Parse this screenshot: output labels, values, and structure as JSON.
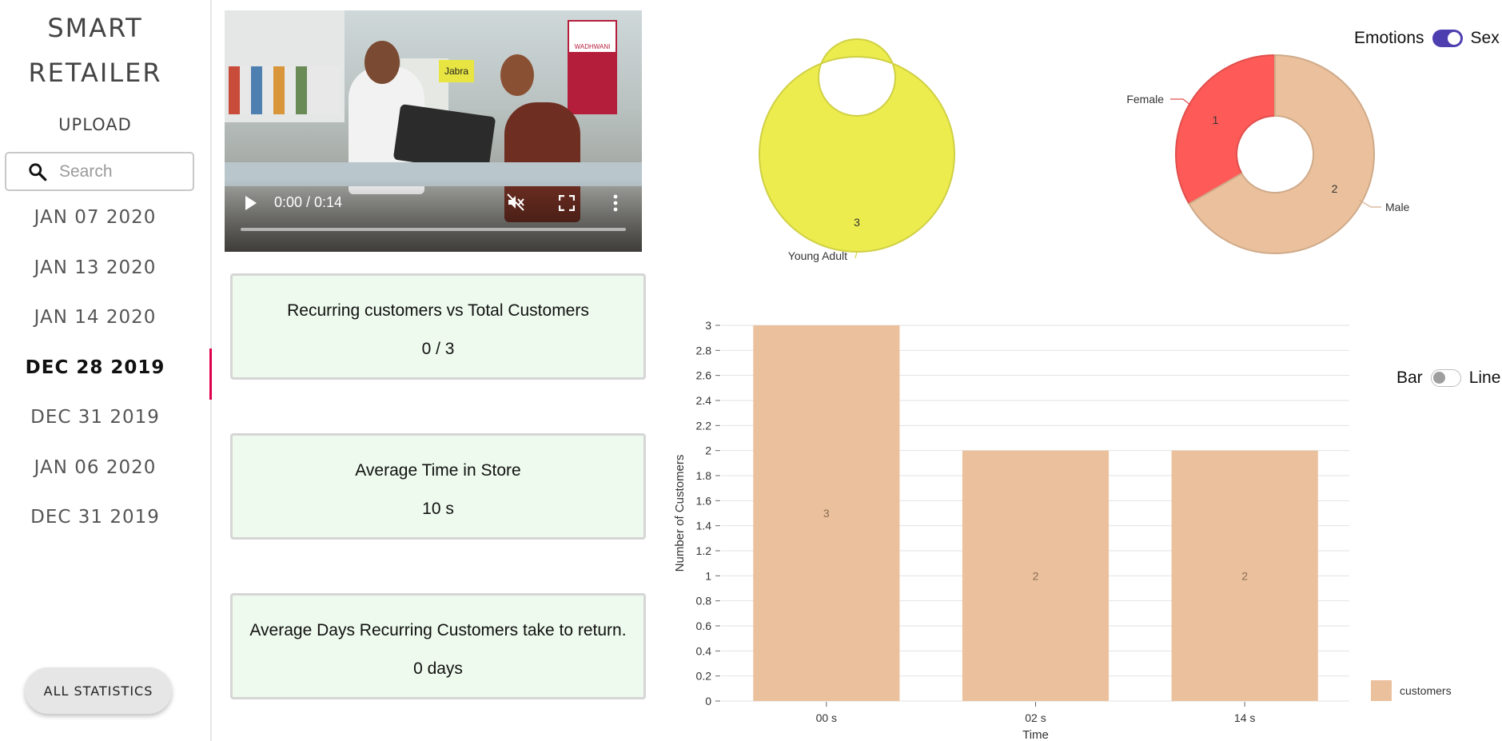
{
  "app": {
    "brand_line1": "SMART",
    "brand_line2": "RETAILER",
    "upload_label": "UPLOAD",
    "search_placeholder": "Search",
    "dates": [
      "JAN 07 2020",
      "JAN 13 2020",
      "JAN 14 2020",
      "DEC 28 2019",
      "DEC 31 2019",
      "JAN 06 2020",
      "DEC 31 2019"
    ],
    "active_date_index": 3,
    "all_stats_label": "ALL STATISTICS"
  },
  "video": {
    "time": "0:00 / 0:14",
    "progress": 0,
    "muted": true,
    "store_sign": "Jabra",
    "brand_sign": "WADHWANI"
  },
  "stats": [
    {
      "title": "Recurring customers vs Total Customers",
      "value": "0 / 3"
    },
    {
      "title": "Average Time in Store",
      "value": "10 s"
    },
    {
      "title": "Average Days Recurring Customers take to return.",
      "value": "0 days"
    }
  ],
  "toggles": {
    "emotions_label": "Emotions",
    "sex_label": "Sex",
    "sex_selected": true,
    "bar_label": "Bar",
    "line_label": "Line",
    "line_selected": false
  },
  "colors": {
    "accent": "#4d3fb0",
    "active_marker": "#e0004d",
    "card_bg": "#eefaed",
    "age_slice": "#ecec4e",
    "male_slice": "#ebc19d",
    "female_slice": "#fe5a57",
    "bar_fill": "#ebc19d"
  },
  "chart_data": [
    {
      "type": "pie",
      "variant": "donut",
      "labels": [
        "Young Adult"
      ],
      "values": [
        3
      ]
    },
    {
      "type": "pie",
      "variant": "donut",
      "labels": [
        "Female",
        "Male"
      ],
      "values": [
        1,
        2
      ]
    },
    {
      "type": "bar",
      "categories": [
        "00 s",
        "02 s",
        "14 s"
      ],
      "series": [
        {
          "name": "customers",
          "values": [
            3,
            2,
            2
          ]
        }
      ],
      "xlabel": "Time",
      "ylabel": "Number of Customers",
      "ylim": [
        0,
        3
      ],
      "yticks": [
        "0",
        "0.2",
        "0.4",
        "0.6",
        "0.8",
        "1",
        "1.2",
        "1.4",
        "1.6",
        "1.8",
        "2",
        "2.2",
        "2.4",
        "2.6",
        "2.8",
        "3"
      ],
      "grid": true,
      "legend": "bottom-right"
    }
  ]
}
